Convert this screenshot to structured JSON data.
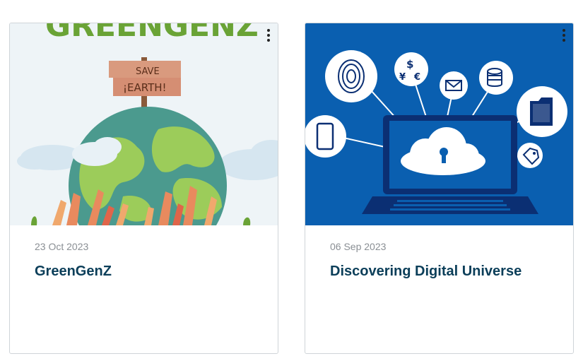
{
  "cards": [
    {
      "date": "23 Oct 2023",
      "title": "GreenGenZ",
      "image": {
        "banner_text": "GREENGENZ",
        "sign_text_line1": "SAVE",
        "sign_text_line2": "¡EARTH!"
      },
      "menu_icon": "more-vertical-icon"
    },
    {
      "date": "06 Sep 2023",
      "title": "Discovering Digital Universe",
      "image": {
        "currency_symbols": [
          "$",
          "¥",
          "€"
        ]
      },
      "menu_icon": "more-vertical-icon"
    }
  ],
  "colors": {
    "title": "#0b3e59",
    "date": "#8a8f94",
    "digital_bg": "#0a5fb0",
    "earth_ocean": "#4b9a8e",
    "earth_land": "#9ccc5a"
  }
}
